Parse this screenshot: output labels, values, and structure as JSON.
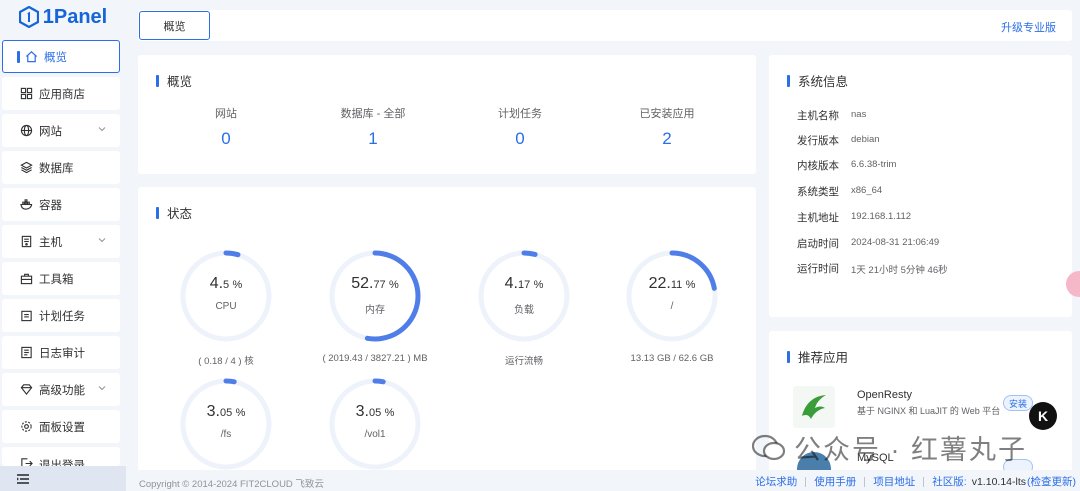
{
  "brand": {
    "name": "1Panel"
  },
  "sidebar": {
    "items": [
      {
        "label": "概览",
        "icon": "home-icon",
        "active": true
      },
      {
        "label": "应用商店",
        "icon": "grid-icon"
      },
      {
        "label": "网站",
        "icon": "globe-icon",
        "expandable": true
      },
      {
        "label": "数据库",
        "icon": "layers-icon"
      },
      {
        "label": "容器",
        "icon": "docker-icon"
      },
      {
        "label": "主机",
        "icon": "server-icon",
        "expandable": true
      },
      {
        "label": "工具箱",
        "icon": "toolbox-icon"
      },
      {
        "label": "计划任务",
        "icon": "calendar-icon"
      },
      {
        "label": "日志审计",
        "icon": "log-icon"
      },
      {
        "label": "高级功能",
        "icon": "diamond-icon",
        "expandable": true
      },
      {
        "label": "面板设置",
        "icon": "gear-icon"
      },
      {
        "label": "退出登录",
        "icon": "logout-icon"
      }
    ]
  },
  "topbar": {
    "tab": "概览",
    "upgrade": "升级专业版"
  },
  "overview": {
    "title": "概览",
    "items": [
      {
        "label": "网站",
        "value": "0"
      },
      {
        "label": "数据库 - 全部",
        "value": "1"
      },
      {
        "label": "计划任务",
        "value": "0"
      },
      {
        "label": "已安装应用",
        "value": "2"
      }
    ]
  },
  "status": {
    "title": "状态",
    "gauges": [
      {
        "value": "4.",
        "decimal": "5",
        "unit": "%",
        "label": "CPU",
        "percent": 4.5,
        "detail": "( 0.18 / 4 ) 核"
      },
      {
        "value": "52.",
        "decimal": "77",
        "unit": "%",
        "label": "内存",
        "percent": 52.77,
        "detail": "( 2019.43 / 3827.21 ) MB"
      },
      {
        "value": "4.",
        "decimal": "17",
        "unit": "%",
        "label": "负载",
        "percent": 4.17,
        "detail": "运行流畅"
      },
      {
        "value": "22.",
        "decimal": "11",
        "unit": "%",
        "label": "/",
        "percent": 22.11,
        "detail": "13.13 GB / 62.6 GB"
      },
      {
        "value": "3.",
        "decimal": "05",
        "unit": "%",
        "label": "/fs",
        "percent": 3.05,
        "detail": ""
      },
      {
        "value": "3.",
        "decimal": "05",
        "unit": "%",
        "label": "/vol1",
        "percent": 3.05,
        "detail": ""
      }
    ]
  },
  "system": {
    "title": "系统信息",
    "rows": [
      {
        "key": "主机名称",
        "value": "nas"
      },
      {
        "key": "发行版本",
        "value": "debian"
      },
      {
        "key": "内核版本",
        "value": "6.6.38-trim"
      },
      {
        "key": "系统类型",
        "value": "x86_64"
      },
      {
        "key": "主机地址",
        "value": "192.168.1.112"
      },
      {
        "key": "启动时间",
        "value": "2024-08-31 21:06:49"
      },
      {
        "key": "运行时间",
        "value": "1天 21小时 5分钟 46秒"
      }
    ]
  },
  "recommend": {
    "title": "推荐应用",
    "apps": [
      {
        "name": "OpenResty",
        "desc": "基于 NGINX 和 LuaJIT 的 Web 平台",
        "action": "安装"
      },
      {
        "name": "MySQL",
        "desc": "",
        "action": ""
      }
    ]
  },
  "footer": {
    "copyright": "Copyright © 2014-2024 FIT2CLOUD 飞致云",
    "links": [
      "论坛求助",
      "使用手册",
      "项目地址"
    ],
    "community": "社区版:",
    "version": "v1.10.14-lts",
    "check_update": "(检查更新)"
  },
  "watermark": {
    "text": "公众号 · 红薯丸子"
  },
  "colors": {
    "accent": "#2a6ee8",
    "background": "#f2f5fa"
  }
}
